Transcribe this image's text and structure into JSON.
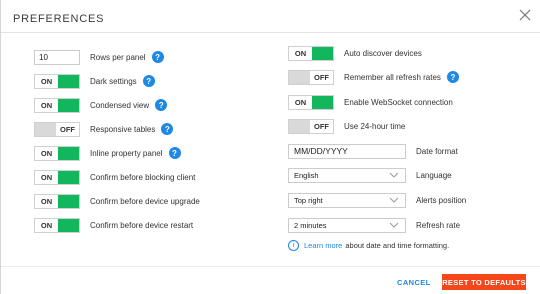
{
  "dialog": {
    "title": "PREFERENCES",
    "close_icon": "close-icon"
  },
  "left": {
    "rows_per_panel": {
      "value": "10",
      "label": "Rows per panel"
    },
    "dark_settings": {
      "state": "ON",
      "label": "Dark settings"
    },
    "condensed_view": {
      "state": "ON",
      "label": "Condensed view"
    },
    "responsive_tables": {
      "state": "OFF",
      "label": "Responsive tables"
    },
    "inline_property_panel": {
      "state": "ON",
      "label": "Inline property panel"
    },
    "confirm_blocking": {
      "state": "ON",
      "label": "Confirm before blocking client"
    },
    "confirm_upgrade": {
      "state": "ON",
      "label": "Confirm before device upgrade"
    },
    "confirm_restart": {
      "state": "ON",
      "label": "Confirm before device restart"
    }
  },
  "right": {
    "auto_discover": {
      "state": "ON",
      "label": "Auto discover devices"
    },
    "remember_refresh": {
      "state": "OFF",
      "label": "Remember all refresh rates"
    },
    "websocket": {
      "state": "ON",
      "label": "Enable WebSocket connection"
    },
    "use_24h": {
      "state": "OFF",
      "label": "Use 24-hour time"
    },
    "date_format": {
      "value": "MM/DD/YYYY",
      "label": "Date format"
    },
    "language": {
      "value": "English",
      "label": "Language"
    },
    "alerts_position": {
      "value": "Top right",
      "label": "Alerts position"
    },
    "refresh_rate": {
      "value": "2 minutes",
      "label": "Refresh rate"
    }
  },
  "info": {
    "link_text": "Learn more",
    "text": "about date and time formatting."
  },
  "footer": {
    "cancel_label": "CANCEL",
    "reset_label": "RESET TO DEFAULTS"
  },
  "colors": {
    "toggle_on": "#12b65d",
    "toggle_off": "#d9d9d9",
    "accent": "#1e88e5",
    "reset_button": "#f5461c"
  }
}
